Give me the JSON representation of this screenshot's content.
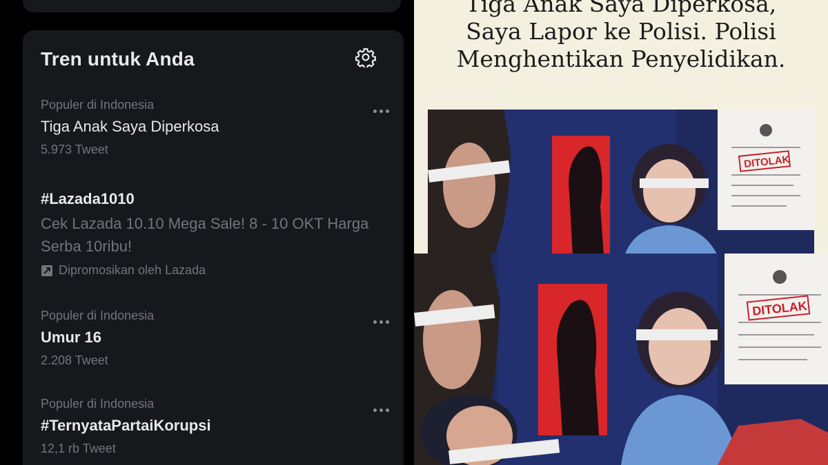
{
  "trends_panel": {
    "title": "Tren untuk Anda",
    "settings_icon": "gear-icon",
    "items": [
      {
        "context": "Populer di Indonesia",
        "name": "Tiga Anak Saya Diperkosa",
        "count": "5.973 Tweet"
      },
      {
        "name": "#Lazada1010",
        "description": "Cek Lazada 10.10 Mega Sale! 8 - 10 OKT Harga Serba 10ribu!",
        "promoted": "Dipromosikan oleh Lazada"
      },
      {
        "context": "Populer di Indonesia",
        "name": "Umur 16",
        "count": "2.208 Tweet"
      },
      {
        "context": "Populer di Indonesia",
        "name": "#TernyataPartaiKorupsi",
        "count": "12,1 rb Tweet"
      }
    ]
  },
  "graphic": {
    "headline_line1": "Tiga Anak Saya Diperkosa,",
    "headline_line2": "Saya Lapor ke Polisi. Polisi",
    "headline_line3": "Menghentikan Penyelidikan.",
    "stamp": "DITOLAK"
  },
  "colors": {
    "panel_bg": "#16181c",
    "text_primary": "#e7e9ea",
    "text_secondary": "#71767b",
    "graphic_bg": "#f4f0df",
    "stamp_red": "#c8202a"
  }
}
